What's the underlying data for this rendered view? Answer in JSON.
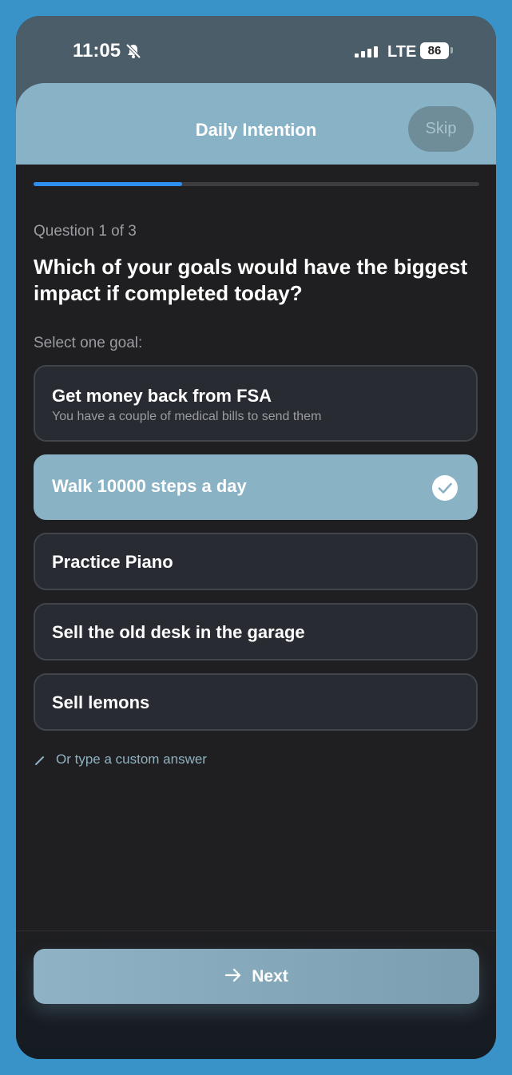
{
  "status_bar": {
    "time": "11:05",
    "network": "LTE",
    "battery": "86"
  },
  "header": {
    "title": "Daily Intention",
    "skip_label": "Skip"
  },
  "progress": {
    "fraction": 0.333
  },
  "question": {
    "count_label": "Question 1 of 3",
    "text": "Which of your goals would have the biggest impact if completed today?",
    "hint": "Select one goal:"
  },
  "options": [
    {
      "title": "Get money back from FSA",
      "subtitle": "You have a couple of medical bills to send them",
      "selected": false
    },
    {
      "title": "Walk 10000 steps a day",
      "selected": true
    },
    {
      "title": "Practice Piano",
      "selected": false
    },
    {
      "title": "Sell the old desk in the garage",
      "selected": false
    },
    {
      "title": "Sell lemons",
      "selected": false
    }
  ],
  "custom_answer_label": "Or type a custom answer",
  "footer": {
    "next_label": "Next"
  },
  "colors": {
    "accent": "#2d8ff0",
    "selected_bg": "#89b2c5",
    "header_bg": "#88b2c6"
  },
  "icons": [
    "bell-slash-icon",
    "signal-icon",
    "battery-icon",
    "check-circle-icon",
    "pencil-icon",
    "arrow-right-icon"
  ]
}
